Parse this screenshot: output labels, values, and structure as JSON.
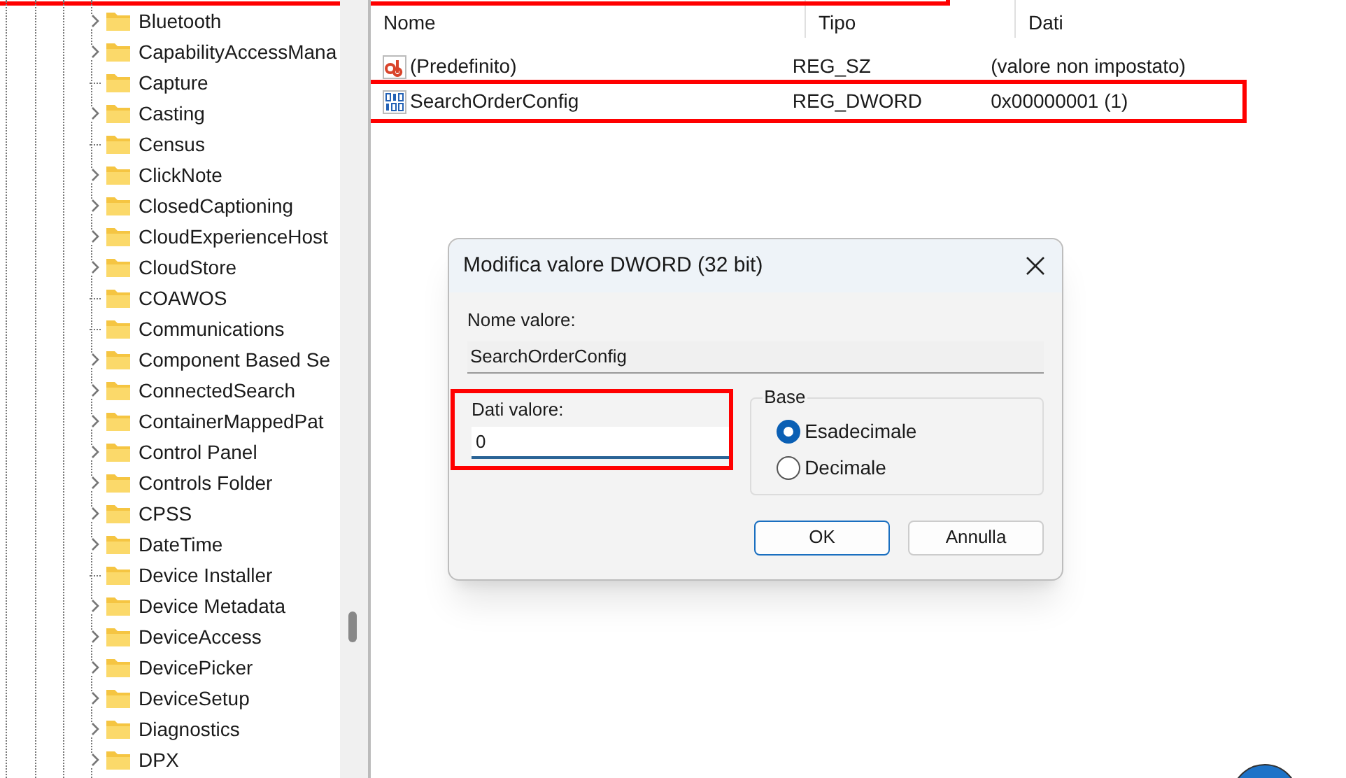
{
  "tree": {
    "items": [
      {
        "label": "Bluetooth",
        "expandable": true
      },
      {
        "label": "CapabilityAccessMana",
        "expandable": true
      },
      {
        "label": "Capture",
        "expandable": false
      },
      {
        "label": "Casting",
        "expandable": true
      },
      {
        "label": "Census",
        "expandable": false
      },
      {
        "label": "ClickNote",
        "expandable": true
      },
      {
        "label": "ClosedCaptioning",
        "expandable": true
      },
      {
        "label": "CloudExperienceHost",
        "expandable": true
      },
      {
        "label": "CloudStore",
        "expandable": true
      },
      {
        "label": "COAWOS",
        "expandable": false
      },
      {
        "label": "Communications",
        "expandable": false
      },
      {
        "label": "Component Based Se",
        "expandable": true
      },
      {
        "label": "ConnectedSearch",
        "expandable": true
      },
      {
        "label": "ContainerMappedPat",
        "expandable": true
      },
      {
        "label": "Control Panel",
        "expandable": true
      },
      {
        "label": "Controls Folder",
        "expandable": true
      },
      {
        "label": "CPSS",
        "expandable": true
      },
      {
        "label": "DateTime",
        "expandable": true
      },
      {
        "label": "Device Installer",
        "expandable": false
      },
      {
        "label": "Device Metadata",
        "expandable": true
      },
      {
        "label": "DeviceAccess",
        "expandable": true
      },
      {
        "label": "DevicePicker",
        "expandable": true
      },
      {
        "label": "DeviceSetup",
        "expandable": true
      },
      {
        "label": "Diagnostics",
        "expandable": true
      },
      {
        "label": "DPX",
        "expandable": true
      }
    ]
  },
  "values": {
    "columns": [
      "Nome",
      "Tipo",
      "Dati"
    ],
    "rows": [
      {
        "kind": "string",
        "name": "(Predefinito)",
        "type": "REG_SZ",
        "data": "(valore non impostato)",
        "highlighted": false
      },
      {
        "kind": "binary",
        "name": "SearchOrderConfig",
        "type": "REG_DWORD",
        "data": "0x00000001 (1)",
        "highlighted": true
      }
    ]
  },
  "dialog": {
    "title": "Modifica valore DWORD (32 bit)",
    "name_label": "Nome valore:",
    "name_value": "SearchOrderConfig",
    "data_label": "Dati valore:",
    "data_value": "0",
    "data_highlighted": true,
    "base_label": "Base",
    "bases": [
      {
        "label": "Esadecimale",
        "selected": true
      },
      {
        "label": "Decimale",
        "selected": false
      }
    ],
    "buttons": [
      {
        "label": "OK",
        "default": true
      },
      {
        "label": "Annulla",
        "default": false
      }
    ]
  }
}
